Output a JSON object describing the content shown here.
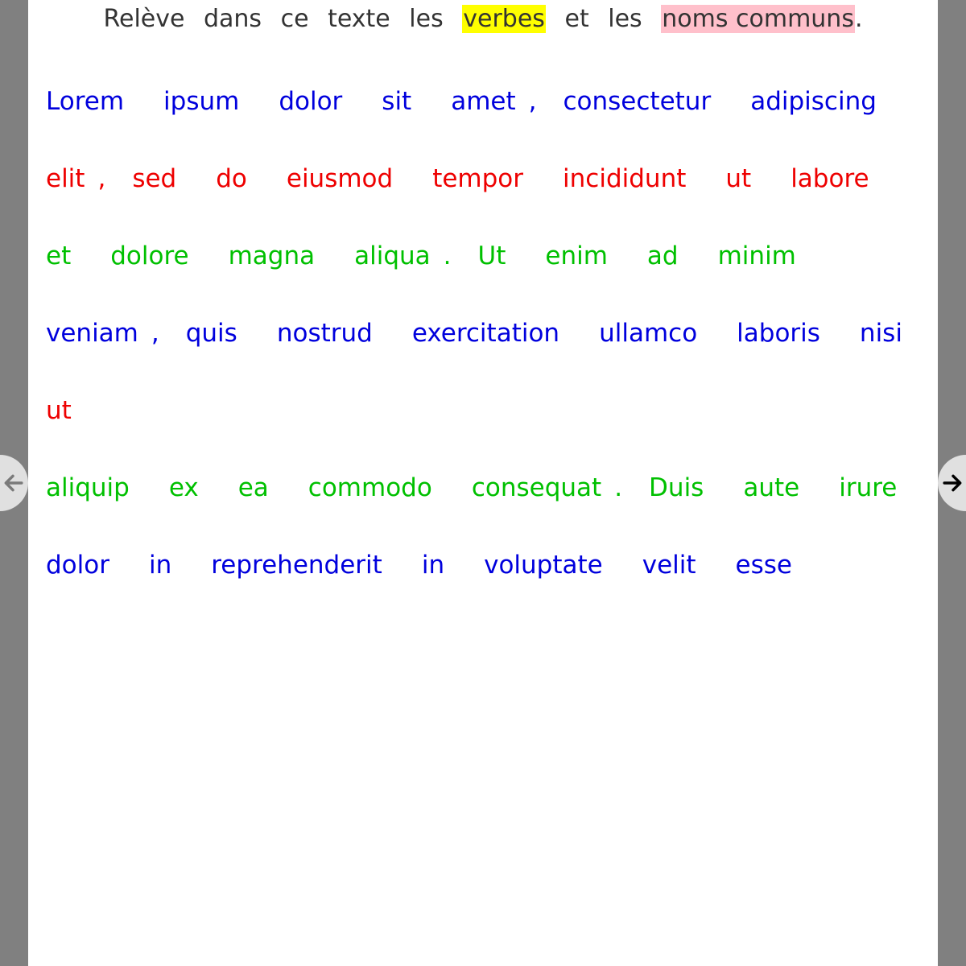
{
  "instruction": {
    "prefix": "Relève dans ce texte les",
    "verb_word": "verbes",
    "middle": "et les",
    "noun_word": "noms communs",
    "suffix": "."
  },
  "colors": {
    "verb_highlight": "#ffff00",
    "noun_highlight": "#ffc0cb",
    "blue_text": "#0000dd",
    "red_text": "#ee0000",
    "green_text": "#00c000"
  },
  "lines": [
    {
      "color": "#0000dd",
      "words": [
        "Lorem",
        "ipsum",
        "dolor",
        "sit",
        "amet",
        ",",
        "consectetur",
        "adipiscing"
      ]
    },
    {
      "color": "#ee0000",
      "words": [
        "elit",
        ",",
        "sed",
        "do",
        "eiusmod",
        "tempor",
        "incididunt",
        "ut",
        "labore"
      ]
    },
    {
      "color": "#00c000",
      "words": [
        "et",
        "dolore",
        "magna",
        "aliqua",
        ".",
        "Ut",
        "enim",
        "ad",
        "minim"
      ]
    },
    {
      "color": "#0000dd",
      "words": [
        "veniam",
        ",",
        "quis",
        "nostrud",
        "exercitation",
        "ullamco",
        "laboris",
        "nisi"
      ]
    },
    {
      "color": "#ee0000",
      "words": [
        "ut"
      ]
    },
    {
      "color": "#00c000",
      "words": [
        "aliquip",
        "ex",
        "ea",
        "commodo",
        "consequat",
        ".",
        "Duis",
        "aute",
        "irure"
      ]
    },
    {
      "color": "#0000dd",
      "words": [
        "dolor",
        "in",
        "reprehenderit",
        "in",
        "voluptate",
        "velit",
        "esse"
      ]
    }
  ],
  "navigation": {
    "prev_icon": "arrow-left-icon",
    "next_icon": "arrow-right-icon"
  }
}
